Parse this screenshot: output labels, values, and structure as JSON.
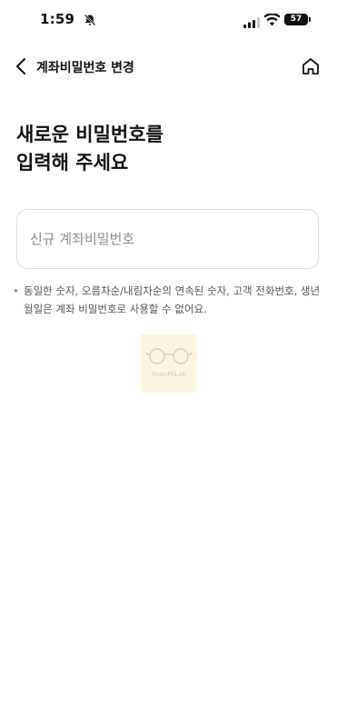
{
  "status_bar": {
    "time": "1:59",
    "battery": "57",
    "icons": [
      "bell-muted-icon",
      "signal-icon",
      "wifi-icon",
      "battery-icon"
    ]
  },
  "navbar": {
    "title": "계좌비밀번호 변경",
    "back_icon": "chevron-left-icon",
    "home_icon": "home-icon"
  },
  "main": {
    "heading_line1": "새로운 비밀번호를",
    "heading_line2": "입력해 주세요",
    "password_input": {
      "value": "",
      "placeholder": "신규 계좌비밀번호"
    },
    "notice_bullet": "•",
    "notice": "동일한 숫자, 오름차순/내림차순의 연속된 숫자, 고객 전화번호, 생년월일은 계좌 비밀번호로 사용할 수 없어요."
  },
  "watermark": {
    "text": "SoonPilLab"
  },
  "colors": {
    "background": "#ffffff",
    "text": "#111111",
    "muted": "#555555",
    "border": "#dcdcdc",
    "placeholder": "#8c8c8c"
  }
}
